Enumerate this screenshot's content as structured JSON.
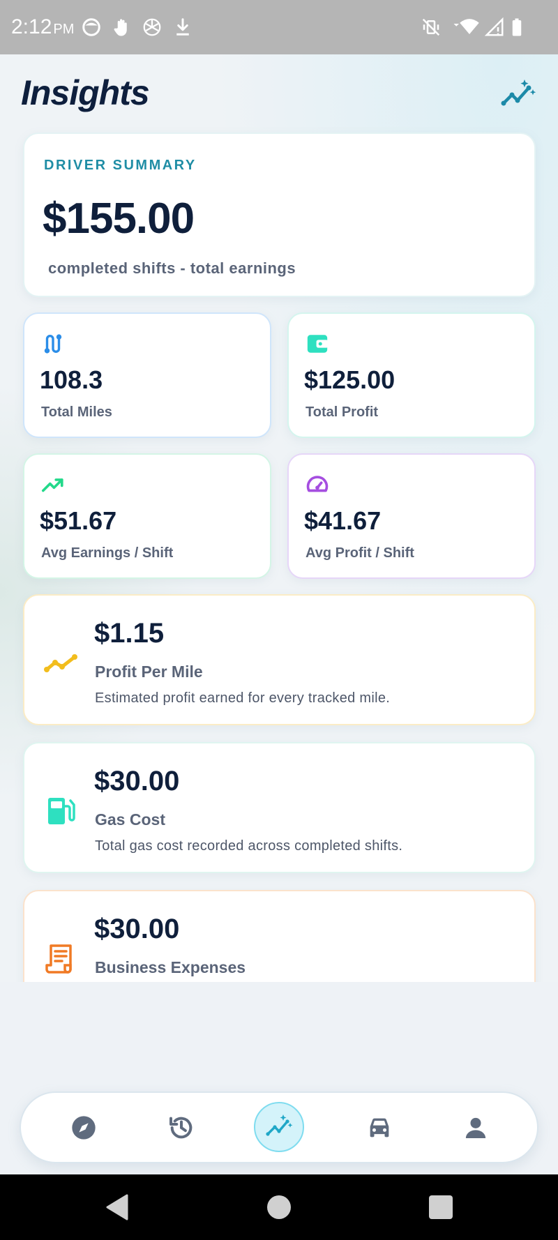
{
  "status_bar": {
    "time": "2:12",
    "ampm": "PM"
  },
  "header": {
    "title": "Insights"
  },
  "summary": {
    "label": "DRIVER SUMMARY",
    "amount": "$155.00",
    "subtitle": "completed shifts - total earnings"
  },
  "stats": [
    {
      "value": "108.3",
      "label": "Total Miles",
      "icon": "route-icon",
      "color": "#2b8de8"
    },
    {
      "value": "$125.00",
      "label": "Total Profit",
      "icon": "wallet-icon",
      "color": "#2ee0c0"
    },
    {
      "value": "$51.67",
      "label": "Avg Earnings / Shift",
      "icon": "trending-up-icon",
      "color": "#22d98a"
    },
    {
      "value": "$41.67",
      "label": "Avg Profit / Shift",
      "icon": "speedometer-icon",
      "color": "#a54ee0"
    }
  ],
  "details": [
    {
      "value": "$1.15",
      "title": "Profit Per Mile",
      "description": "Estimated profit earned for every tracked mile.",
      "icon": "line-chart-icon",
      "color": "#f2bd1d"
    },
    {
      "value": "$30.00",
      "title": "Gas Cost",
      "description": "Total gas cost recorded across completed shifts.",
      "icon": "gas-pump-icon",
      "color": "#2ee0c0"
    },
    {
      "value": "$30.00",
      "title": "Business Expenses",
      "description": "",
      "icon": "receipt-icon",
      "color": "#f07a25"
    }
  ],
  "nav": {
    "items": [
      "explore-icon",
      "history-icon",
      "insights-icon",
      "car-icon",
      "profile-icon"
    ],
    "active": "insights-icon"
  },
  "colors": {
    "accent": "#1f8da5",
    "nav_inactive": "#5f6b7e",
    "nav_active_bg": "#d4f3fa"
  }
}
